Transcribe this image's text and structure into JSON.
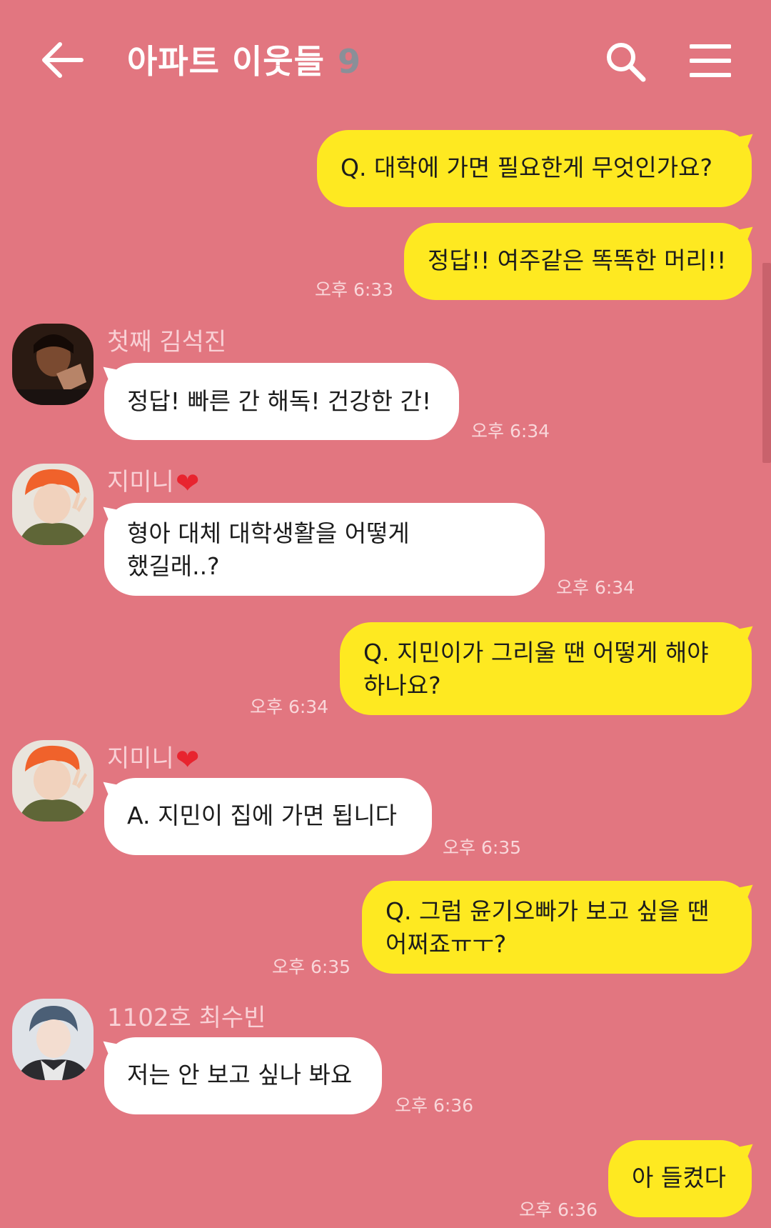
{
  "header": {
    "back_icon": "arrow-left-icon",
    "title": "아파트 이웃들",
    "member_count": "9",
    "search_icon": "search-icon",
    "menu_icon": "hamburger-menu-icon"
  },
  "messages": [
    {
      "side": "me",
      "lines": [
        "Q. 대학에 가면 필요한게 무엇인가요?"
      ]
    },
    {
      "side": "me",
      "lines": [
        "정답!! 여주같은 똑똑한 머리!!"
      ],
      "time": "오후 6:33"
    },
    {
      "side": "other",
      "sender": "첫째 김석진",
      "lines": [
        "정답! 빠른 간 해독! 건강한 간!"
      ],
      "time": "오후 6:34"
    },
    {
      "side": "other",
      "sender": "지미니",
      "lines": [
        "형아 대체 대학생활을 어떻게",
        "했길래..?"
      ],
      "time": "오후 6:34"
    },
    {
      "side": "me",
      "lines": [
        "Q. 지민이가 그리울 땐 어떻게 해야",
        "하나요?"
      ],
      "time": "오후 6:34"
    },
    {
      "side": "other",
      "sender": "지미니",
      "lines": [
        "A. 지민이 집에 가면 됩니다"
      ],
      "time": "오후 6:35"
    },
    {
      "side": "me",
      "lines": [
        "Q. 그럼 윤기오빠가 보고 싶을 땐",
        "어쩌죠ㅠㅜ?"
      ],
      "time": "오후 6:35"
    },
    {
      "side": "other",
      "sender": "1102호 최수빈",
      "lines": [
        "저는 안 보고 싶나 봐요"
      ],
      "time": "오후 6:36"
    },
    {
      "side": "me",
      "lines": [
        "아 들켰다"
      ],
      "time": "오후 6:36"
    }
  ],
  "colors": {
    "background": "#e27680",
    "my_bubble": "#fee921",
    "other_bubble": "#ffffff",
    "heart": "#e8242f"
  }
}
